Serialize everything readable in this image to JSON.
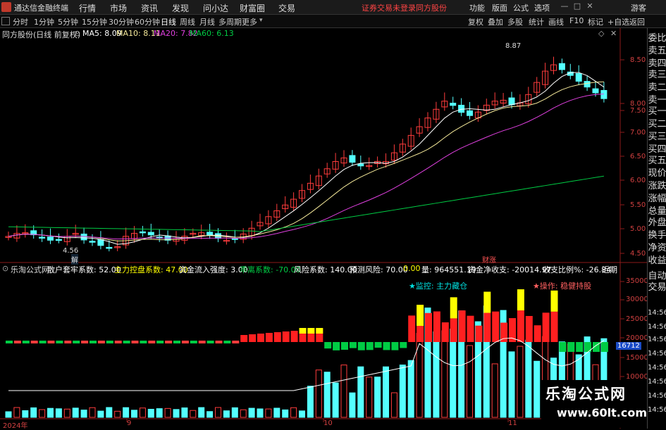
{
  "titlebar": {
    "app_name": "通达信金融终端",
    "menus": [
      "行情",
      "市场",
      "资讯",
      "发现",
      "问小达",
      "财富圈",
      "交易"
    ],
    "notice": "证券交易未登录",
    "stock": "同方股份",
    "right_items": [
      "功能",
      "版面",
      "公式",
      "选项"
    ],
    "user": "游客"
  },
  "periodbar": {
    "periods": [
      "分时",
      "1分钟",
      "5分钟",
      "15分钟",
      "30分钟",
      "60分钟",
      "日线",
      "周线",
      "月线",
      "多周期",
      "更多"
    ],
    "active": "日线",
    "right_buttons": [
      "复权",
      "叠加",
      "多股",
      "统计",
      "画线",
      "F10",
      "标记",
      "+自选",
      "返回"
    ]
  },
  "kline": {
    "title": "同方股份(日线 前复权)",
    "ma": [
      {
        "label": "MA5: 8.09",
        "color": "#ffffff"
      },
      {
        "label": "MA10: 8.11",
        "color": "#f5e99a"
      },
      {
        "label": "MA20: 7.82",
        "color": "#e040e0"
      },
      {
        "label": "MA60: 6.13",
        "color": "#00cc44"
      }
    ],
    "high_label": "8.87",
    "low_label": "4.56",
    "events": [
      "解",
      "财涨"
    ],
    "price_axis": [
      "8.50",
      "8.00",
      "7.50",
      "7.00",
      "6.50",
      "6.00",
      "5.50",
      "5.00",
      "4.50"
    ]
  },
  "indicator": {
    "name": "乐淘公式网",
    "params": [
      {
        "label": "散户套牢系数: 52.00",
        "color": "#ffffff"
      },
      {
        "label": "主力控盘系数: 47.00",
        "color": "#ffff00"
      },
      {
        "label": "资金流入强度: 3.00",
        "color": "#ffffff"
      },
      {
        "label": "乖离系数: -70.00",
        "color": "#00cc44"
      },
      {
        "label": "风险系数: 140.00",
        "color": "#ffffff"
      },
      {
        "label": "预测风险: 70.00",
        "color": "#ffffff"
      },
      {
        "label": "0.00",
        "color": "#ffff00"
      },
      {
        "label": "量: 964551.19",
        "color": "#ffffff"
      },
      {
        "label": "资金净收支: -20014.97",
        "color": "#ffffff"
      },
      {
        "label": "收支比例%: -26.84",
        "color": "#ffffff"
      },
      {
        "label": "近期",
        "color": "#ffffff"
      }
    ],
    "monitor": "★监控: 主力藏仓",
    "operation": "★操作: 稳健持股",
    "value_axis": [
      "35000",
      "30000",
      "25000",
      "20000",
      "15000",
      "10000"
    ],
    "current_value": "16712"
  },
  "dates": [
    "2024年",
    "9",
    "10",
    "11"
  ],
  "right_panel": [
    "委比",
    "卖五",
    "卖四",
    "卖三",
    "卖二",
    "卖一",
    "买一",
    "买二",
    "买三",
    "买四",
    "买五",
    "现价",
    "涨跌",
    "涨幅",
    "总量",
    "外盘",
    "换手",
    "净资",
    "收益",
    "自动",
    "交易",
    "14:56",
    "14:56",
    "14:56",
    "14:56",
    "14:56",
    "14:56",
    "14:56",
    "14:56"
  ],
  "watermark": {
    "line1": "乐淘公式网",
    "line2": "www.60lt.com"
  }
}
